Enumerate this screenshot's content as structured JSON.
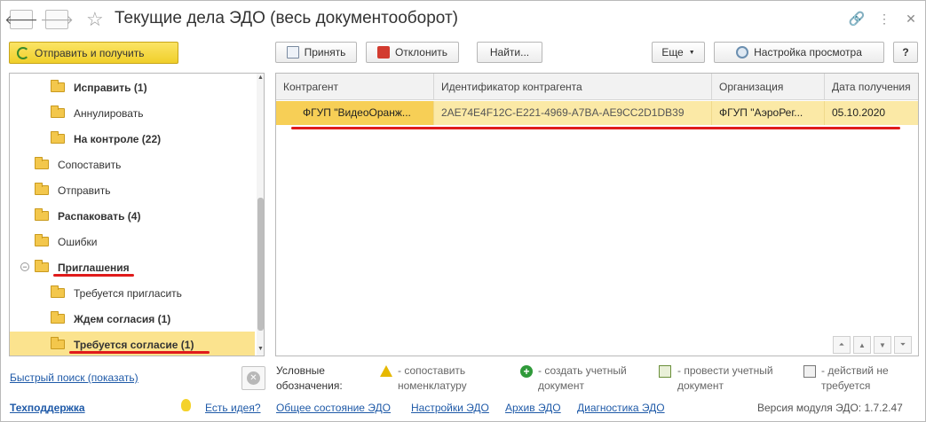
{
  "window": {
    "title": "Текущие дела ЭДО (весь документооборот)"
  },
  "toolbar": {
    "send_receive": "Отправить и получить",
    "accept": "Принять",
    "reject": "Отклонить",
    "find": "Найти...",
    "more": "Еще",
    "view_settings": "Настройка просмотра",
    "help": "?"
  },
  "tree": {
    "items": [
      {
        "label": "Исправить (1)",
        "bold": true,
        "level": 2
      },
      {
        "label": "Аннулировать",
        "bold": false,
        "level": 2
      },
      {
        "label": "На контроле (22)",
        "bold": true,
        "level": 2
      },
      {
        "label": "Сопоставить",
        "bold": false,
        "level": 1
      },
      {
        "label": "Отправить",
        "bold": false,
        "level": 1
      },
      {
        "label": "Распаковать (4)",
        "bold": true,
        "level": 1
      },
      {
        "label": "Ошибки",
        "bold": false,
        "level": 1
      },
      {
        "label": "Приглашения",
        "bold": true,
        "level": 1,
        "expander": "⊖"
      },
      {
        "label": "Требуется пригласить",
        "bold": false,
        "level": 2
      },
      {
        "label": "Ждем согласия (1)",
        "bold": true,
        "level": 2
      },
      {
        "label": "Требуется согласие (1)",
        "bold": true,
        "level": 2,
        "selected": true
      }
    ]
  },
  "table": {
    "columns": [
      "Контрагент",
      "Идентификатор контрагента",
      "Организация",
      "Дата получения"
    ],
    "rows": [
      [
        "ФГУП \"ВидеоОранж...",
        "2AE74E4F12C-E221-4969-A7BA-AE9CC2D1DB39",
        "ФГУП \"АэроРег...",
        "05.10.2020"
      ]
    ]
  },
  "legend": {
    "title_line1": "Условные",
    "title_line2": "обозначения:",
    "items": [
      {
        "icon": "warning-icon",
        "line1": "- сопоставить",
        "line2": "номенклатуру"
      },
      {
        "icon": "plus-circle-icon",
        "line1": "- создать учетный",
        "line2": "документ"
      },
      {
        "icon": "post-document-icon",
        "line1": "- провести учетный",
        "line2": "документ"
      },
      {
        "icon": "no-action-icon",
        "line1": "- действий не",
        "line2": "требуется"
      }
    ]
  },
  "quick_search": "Быстрый поиск (показать)",
  "footer": {
    "support": "Техподдержка",
    "idea": "Есть идея?",
    "general_state": "Общее состояние ЭДО",
    "settings": "Настройки ЭДО",
    "archive": "Архив ЭДО",
    "diagnostics": "Диагностика ЭДО",
    "version": "Версия модуля ЭДО: 1.7.2.47"
  },
  "colors": {
    "accent_yellow": "#f3d64a",
    "selection": "#fbe38e",
    "link": "#1f5aa8",
    "annotation_red": "#e01b1b"
  }
}
